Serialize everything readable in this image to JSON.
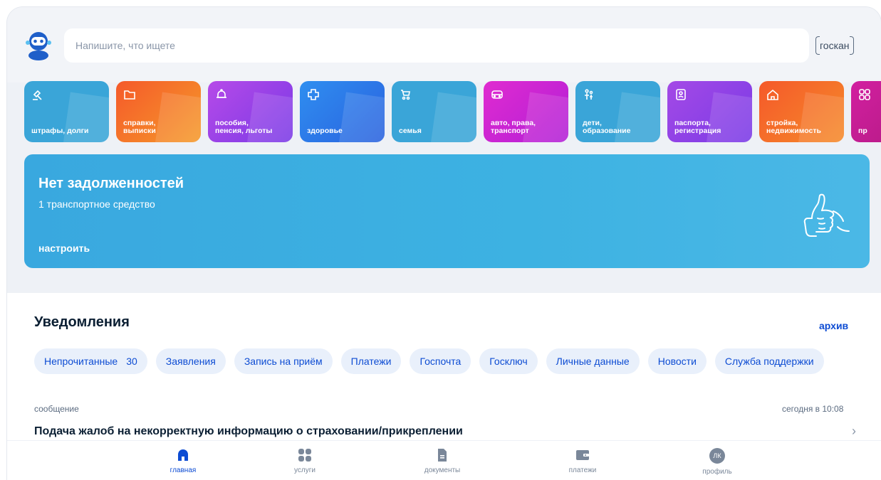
{
  "search": {
    "placeholder": "Напишите, что ищете",
    "scan_label": "госкан"
  },
  "categories": [
    {
      "label": "штрафы, долги",
      "icon": "gavel-icon",
      "color": "#3aa5d8"
    },
    {
      "label": "справки,\nвыписки",
      "icon": "folder-icon",
      "color": "#f57b2a"
    },
    {
      "label": "пособия,\nпенсия, льготы",
      "icon": "bell-icon",
      "color": "#9b45e6"
    },
    {
      "label": "здоровье",
      "icon": "medical-cross-icon",
      "color": "#2f7fe8"
    },
    {
      "label": "семья",
      "icon": "stroller-icon",
      "color": "#3aa5d8"
    },
    {
      "label": "авто, права,\nтранспорт",
      "icon": "car-icon",
      "color": "#cf2fd6"
    },
    {
      "label": "дети,\nобразование",
      "icon": "family-icon",
      "color": "#3aa5d8"
    },
    {
      "label": "паспорта,\nрегистрация",
      "icon": "passport-icon",
      "color": "#9b45e6"
    },
    {
      "label": "стройка,\nнедвижимость",
      "icon": "house-icon",
      "color": "#f57b2a"
    },
    {
      "label": "пр",
      "icon": "grid-icon",
      "color": "#c21a8c"
    }
  ],
  "banner": {
    "title": "Нет задолженностей",
    "subtitle": "1 транспортное средство",
    "action": "настроить"
  },
  "notifications": {
    "heading": "Уведомления",
    "archive": "архив",
    "chips": [
      {
        "label": "Непрочитанные",
        "count": "30"
      },
      {
        "label": "Заявления"
      },
      {
        "label": "Запись на приём"
      },
      {
        "label": "Платежи"
      },
      {
        "label": "Госпочта"
      },
      {
        "label": "Госключ"
      },
      {
        "label": "Личные данные"
      },
      {
        "label": "Новости"
      },
      {
        "label": "Служба поддержки"
      }
    ],
    "message": {
      "type": "сообщение",
      "time": "сегодня в 10:08",
      "title": "Подача жалоб на некорректную информацию о страховании/прикреплении"
    }
  },
  "nav": {
    "home": "главная",
    "services": "услуги",
    "documents": "документы",
    "payments": "платежи",
    "profile": "профиль",
    "avatar_initials": "ЛК"
  },
  "colors": {
    "accent": "#0d4cd3",
    "banner": "#3db2e2"
  }
}
